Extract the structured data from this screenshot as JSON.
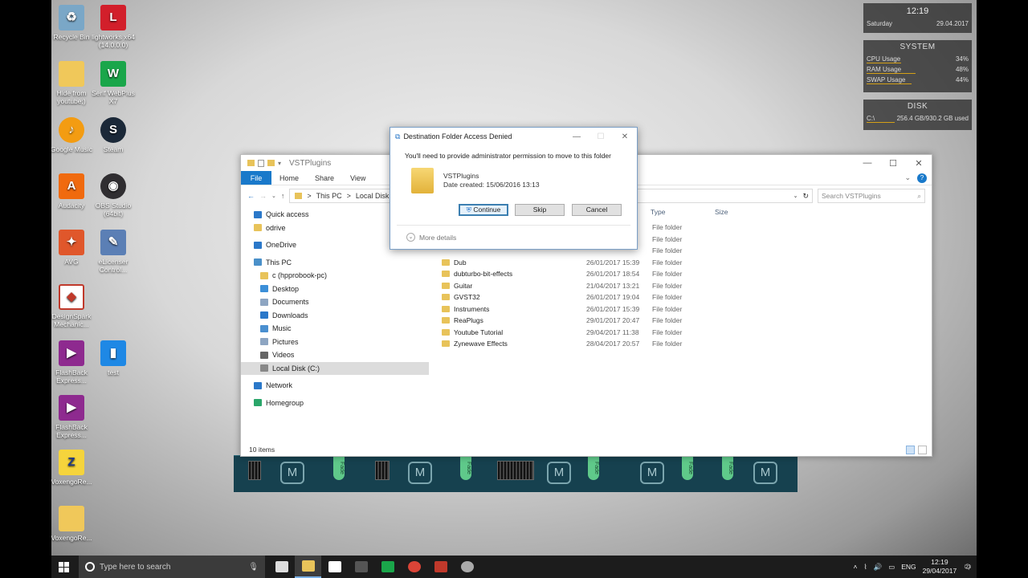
{
  "desktop_icons": [
    {
      "label": "Recycle Bin",
      "icon": "recycle-bin-icon",
      "color": "#7aa7c7"
    },
    {
      "label": "lightworks x64 (14.0.0.0)",
      "icon": "lightworks-icon",
      "color": "#d21f2b"
    },
    {
      "label": "Hide from youtube;)",
      "icon": "folder-icon",
      "color": "#f0c85a"
    },
    {
      "label": "Serif WebPlus X7",
      "icon": "webplus-icon",
      "color": "#1aa64a"
    },
    {
      "label": "Google Music",
      "icon": "google-music-icon",
      "color": "#f39c12"
    },
    {
      "label": "Steam",
      "icon": "steam-icon",
      "color": "#1b2838"
    },
    {
      "label": "Audacity",
      "icon": "audacity-icon",
      "color": "#f06a0e"
    },
    {
      "label": "OBS Studio (64bit)",
      "icon": "obs-icon",
      "color": "#302e31"
    },
    {
      "label": "AVG",
      "icon": "avg-icon",
      "color": "#e0572b"
    },
    {
      "label": "eLicenser Control...",
      "icon": "elicenser-icon",
      "color": "#5b7fb5"
    },
    {
      "label": "DesignSpark Mechanic...",
      "icon": "designspark-icon",
      "color": "#c0392b"
    },
    {
      "label": "FlashBack Express...",
      "icon": "flashback-icon",
      "color": "#8e2a8f"
    },
    {
      "label": "test",
      "icon": "video-file-icon",
      "color": "#1e88e5"
    },
    {
      "label": "FlashBack Express...",
      "icon": "flashback-icon",
      "color": "#8e2a8f"
    },
    {
      "label": "VoxengoRe...",
      "icon": "voxengo-icon",
      "color": "#f5d43c"
    },
    {
      "label": "VoxengoRe...",
      "icon": "voxengo-icon",
      "color": "#f0c85a"
    }
  ],
  "widgets": {
    "clock": {
      "time": "12:19",
      "day": "Saturday",
      "date": "29.04.2017"
    },
    "system": {
      "title": "SYSTEM",
      "rows": [
        {
          "label": "CPU Usage",
          "value": "34%",
          "level": 0.34
        },
        {
          "label": "RAM Usage",
          "value": "48%",
          "level": 0.48
        },
        {
          "label": "SWAP Usage",
          "value": "44%",
          "level": 0.44
        }
      ]
    },
    "disk": {
      "title": "DISK",
      "drive": "C:\\",
      "usage": "256.4 GB/930.2 GB used",
      "level": 0.28
    }
  },
  "daw": {
    "mute_label": "M",
    "fader_label": "Fade"
  },
  "explorer": {
    "title": "VSTPlugins",
    "ribbon": {
      "file": "File",
      "home": "Home",
      "share": "Share",
      "view": "View",
      "help": "?"
    },
    "address": {
      "this_pc": "This PC",
      "local_disk": "Local Disk (",
      "sep": ">"
    },
    "search_placeholder": "Search VSTPlugins",
    "nav": [
      {
        "label": "Quick access",
        "icon": "star-icon",
        "color": "#2b78c9",
        "indent": 16
      },
      {
        "label": "odrive",
        "icon": "folder-icon",
        "color": "#e8c35a",
        "indent": 16
      },
      {
        "label": "OneDrive",
        "icon": "cloud-icon",
        "color": "#2b78c9",
        "indent": 16
      },
      {
        "label": "This PC",
        "icon": "computer-icon",
        "color": "#4a90c9",
        "indent": 16
      },
      {
        "label": "c (hpprobook-pc)",
        "icon": "network-drive-icon",
        "color": "#e8c35a",
        "indent": 24
      },
      {
        "label": "Desktop",
        "icon": "desktop-icon",
        "color": "#3c8fd8",
        "indent": 24
      },
      {
        "label": "Documents",
        "icon": "documents-icon",
        "color": "#8da5c2",
        "indent": 24
      },
      {
        "label": "Downloads",
        "icon": "downloads-icon",
        "color": "#2b78c9",
        "indent": 24
      },
      {
        "label": "Music",
        "icon": "music-icon",
        "color": "#4a8fd0",
        "indent": 24
      },
      {
        "label": "Pictures",
        "icon": "pictures-icon",
        "color": "#8da5c2",
        "indent": 24
      },
      {
        "label": "Videos",
        "icon": "videos-icon",
        "color": "#666666",
        "indent": 24
      },
      {
        "label": "Local Disk (C:)",
        "icon": "disk-icon",
        "color": "#888888",
        "indent": 24,
        "selected": true
      },
      {
        "label": "Network",
        "icon": "network-icon",
        "color": "#2b78c9",
        "indent": 16
      },
      {
        "label": "Homegroup",
        "icon": "homegroup-icon",
        "color": "#2aa66a",
        "indent": 16
      }
    ],
    "columns": {
      "type": "Type",
      "size": "Size"
    },
    "files": [
      {
        "name": "",
        "date": "",
        "type": "File folder"
      },
      {
        "name": "",
        "date": "",
        "type": "File folder"
      },
      {
        "name": "",
        "date": "",
        "type": "File folder"
      },
      {
        "name": "Dub",
        "date": "26/01/2017 15:39",
        "type": "File folder"
      },
      {
        "name": "dubturbo-bit-effects",
        "date": "26/01/2017 18:54",
        "type": "File folder"
      },
      {
        "name": "Guitar",
        "date": "21/04/2017 13:21",
        "type": "File folder"
      },
      {
        "name": "GVST32",
        "date": "26/01/2017 19:04",
        "type": "File folder"
      },
      {
        "name": "Instruments",
        "date": "26/01/2017 15:39",
        "type": "File folder"
      },
      {
        "name": "ReaPlugs",
        "date": "29/01/2017 20:47",
        "type": "File folder"
      },
      {
        "name": "Youtube Tutorial",
        "date": "29/04/2017 11:38",
        "type": "File folder"
      },
      {
        "name": "Zynewave Effects",
        "date": "28/04/2017 20:57",
        "type": "File folder"
      }
    ],
    "status": "10 items"
  },
  "dialog": {
    "title": "Destination Folder Access Denied",
    "message": "You'll need to provide administrator permission to move to this folder",
    "folder_name": "VSTPlugins",
    "date_created": "Date created: 15/06/2016 13:13",
    "continue": "Continue",
    "skip": "Skip",
    "cancel": "Cancel",
    "more_details": "More details"
  },
  "taskbar": {
    "search_placeholder": "Type here to search",
    "apps": [
      {
        "name": "task-view-icon",
        "color": "#dddddd"
      },
      {
        "name": "file-explorer-icon",
        "color": "#e8c35a"
      },
      {
        "name": "store-icon",
        "color": "#ffffff"
      },
      {
        "name": "lightworks-icon",
        "color": "#555555"
      },
      {
        "name": "webplus-icon",
        "color": "#1aa64a"
      },
      {
        "name": "chrome-icon",
        "color": "#db4437"
      },
      {
        "name": "video-editor-icon",
        "color": "#c0392b"
      },
      {
        "name": "obs-icon",
        "color": "#aaaaaa"
      }
    ],
    "language": "ENG",
    "time": "12:19",
    "date": "29/04/2017",
    "notifications": "23"
  }
}
